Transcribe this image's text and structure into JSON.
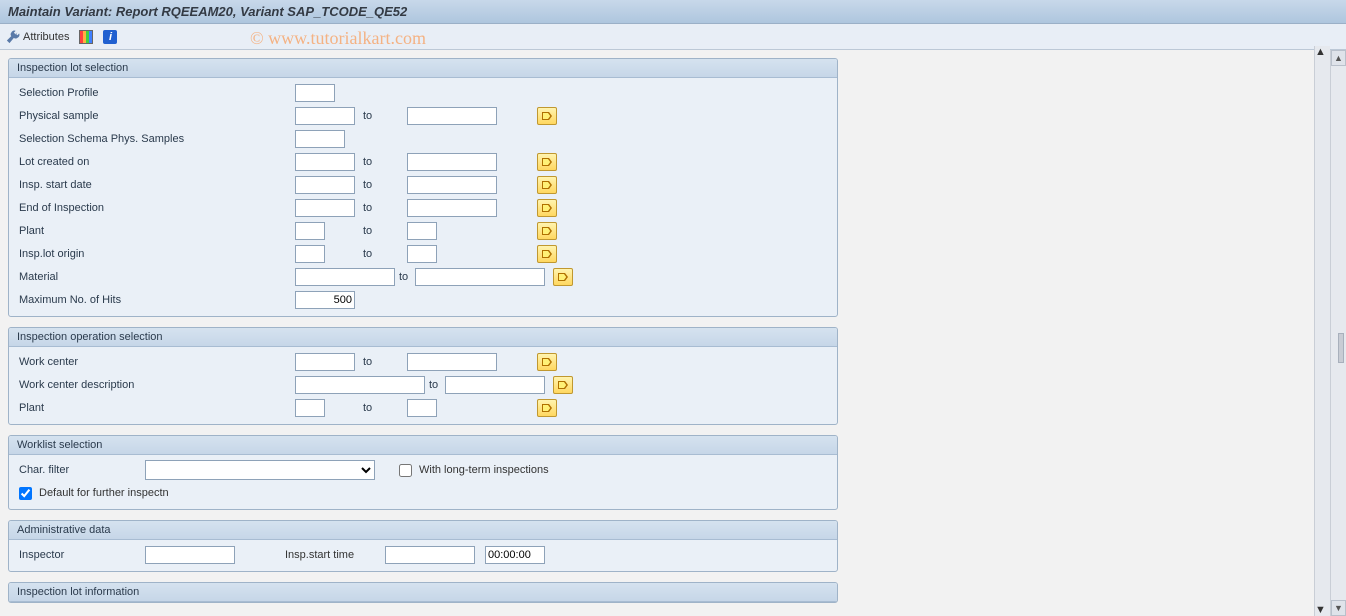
{
  "title": "Maintain Variant: Report RQEEAM20, Variant SAP_TCODE_QE52",
  "watermark": "© www.tutorialkart.com",
  "toolbar": {
    "attributes_label": "Attributes"
  },
  "groups": {
    "lot": {
      "title": "Inspection lot selection",
      "selection_profile": "Selection Profile",
      "physical_sample": "Physical sample",
      "selection_schema": "Selection Schema Phys. Samples",
      "lot_created_on": "Lot created on",
      "insp_start_date": "Insp. start date",
      "end_of_inspection": "End of Inspection",
      "plant": "Plant",
      "insp_lot_origin": "Insp.lot origin",
      "material": "Material",
      "max_hits": "Maximum No. of Hits",
      "max_hits_value": "500",
      "to": "to"
    },
    "op": {
      "title": "Inspection operation selection",
      "work_center": "Work center",
      "work_center_desc": "Work center description",
      "plant": "Plant",
      "to": "to"
    },
    "worklist": {
      "title": "Worklist selection",
      "char_filter": "Char. filter",
      "long_term": "With long-term inspections",
      "default_further": "Default for further inspectn"
    },
    "admin": {
      "title": "Administrative data",
      "inspector": "Inspector",
      "insp_start_time": "Insp.start time",
      "time_value": "00:00:00"
    },
    "lotinfo": {
      "title": "Inspection lot information"
    }
  }
}
